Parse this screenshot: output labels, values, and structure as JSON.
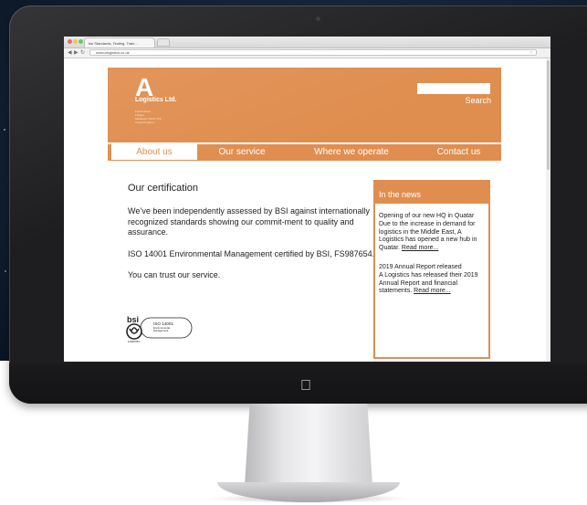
{
  "browser": {
    "tab_title": "bsi Standards, Testing, Train...",
    "url": "www.alogistics.co.uk"
  },
  "site": {
    "logo_letter": "A",
    "company_name": "Logistics Ltd.",
    "address": [
      "Fourth Road",
      "Fulham",
      "Middlesex SW12 7FF",
      "United Kingdom"
    ],
    "search_label": "Search",
    "search_value": "",
    "nav": [
      "About us",
      "Our service",
      "Where we operate",
      "Contact us"
    ],
    "active_nav": "About us"
  },
  "main": {
    "heading": "Our certification",
    "paragraphs": [
      "We’ve been independently assessed by BSI against internationally recognized standards showing our commit-ment to quality and assurance.",
      "ISO 14001 Environmental Management certified by BSI, FS987654.",
      "You can trust our service."
    ],
    "badge": {
      "brand": "bsi",
      "standard": "ISO 14001",
      "line2": "Environmental",
      "line3": "Management",
      "cert_no": "FS987654"
    }
  },
  "news": {
    "heading": "In the news",
    "items": [
      {
        "title": "Opening of our new HQ in Quatar",
        "body": "Due to the increase in demand for logistics in the Middle East, A Logistics has opened a new hub in Quatar.",
        "link": "Read more..."
      },
      {
        "title": "2019 Annual Report released",
        "body": "A Logistics has released their 2019 Annual Report and financial statements.",
        "link": "Read more..."
      }
    ]
  },
  "colors": {
    "brand_orange": "#e08e50",
    "space_blue": "#16263b"
  }
}
